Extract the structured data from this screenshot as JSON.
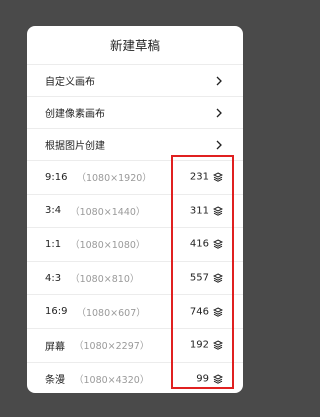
{
  "dialog": {
    "title": "新建草稿",
    "menu_items": [
      {
        "label": "自定义画布",
        "icon": "chevron-right-icon"
      },
      {
        "label": "创建像素画布",
        "icon": "chevron-right-icon"
      },
      {
        "label": "根据图片创建",
        "icon": "chevron-right-icon"
      }
    ],
    "presets": [
      {
        "ratio": "9:16",
        "size": "（1080×1920）",
        "count": "231",
        "icon": "layers-icon"
      },
      {
        "ratio": "3:4",
        "size": "（1080×1440）",
        "count": "311",
        "icon": "layers-icon"
      },
      {
        "ratio": "1:1",
        "size": "（1080×1080）",
        "count": "416",
        "icon": "layers-icon"
      },
      {
        "ratio": "4:3",
        "size": "（1080×810）",
        "count": "557",
        "icon": "layers-icon"
      },
      {
        "ratio": "16:9",
        "size": "（1080×607）",
        "count": "746",
        "icon": "layers-icon"
      },
      {
        "ratio": "屏幕",
        "size": "（1080×2297）",
        "count": "192",
        "icon": "layers-icon"
      },
      {
        "ratio": "条漫",
        "size": "（1080×4320）",
        "count": "99",
        "icon": "layers-icon"
      }
    ]
  },
  "colors": {
    "overlay": "#4a4a4a",
    "dialog_bg": "#ffffff",
    "highlight": "#e02020",
    "secondary_text": "#9a9a9a"
  }
}
